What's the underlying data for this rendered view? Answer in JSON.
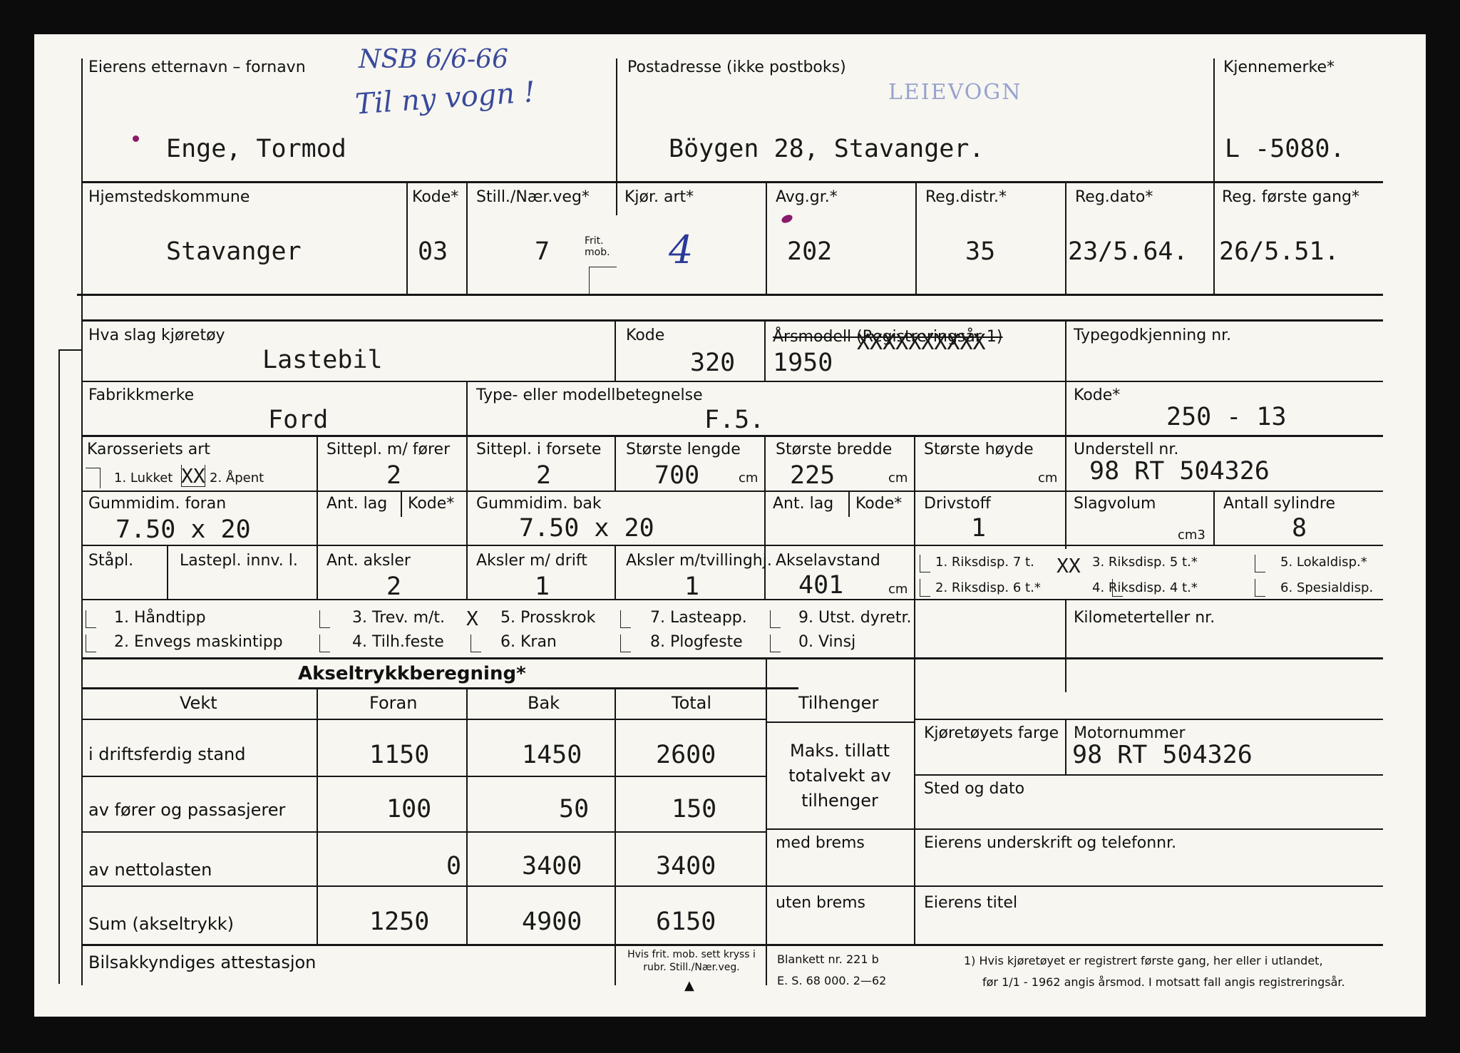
{
  "header": {
    "owner_label": "Eierens etternavn – fornavn",
    "owner_value": "Enge, Tormod",
    "annotation_line1": "NSB 6/6-66",
    "annotation_line2": "Til ny vogn !",
    "address_label": "Postadresse (ikke postboks)",
    "address_value": "Böygen 28, Stavanger.",
    "stamp": "LEIEVOGN",
    "reg_mark_label": "Kjennemerke*",
    "reg_mark_value": "L -5080."
  },
  "row2": {
    "municipality_label": "Hjemstedskommune",
    "municipality_value": "Stavanger",
    "kode_label": "Kode*",
    "kode_value": "03",
    "stilling_label": "Still./Nær.veg*",
    "stilling_value": "7",
    "frit_mob_label": "Frit. mob.",
    "kjor_art_label": "Kjør. art*",
    "kjor_art_value": "4",
    "avg_gr_label": "Avg.gr.*",
    "avg_gr_value": "202",
    "reg_distr_label": "Reg.distr.*",
    "reg_distr_value": "35",
    "reg_dato_label": "Reg.dato*",
    "reg_dato_value": "23/5.64.",
    "first_reg_label": "Reg. første gang*",
    "first_reg_value": "26/5.51."
  },
  "vehicle": {
    "type_label": "Hva slag kjøretøy",
    "type_value": "Lastebil",
    "kode_label": "Kode",
    "kode_value": "320",
    "year_label": "Årsmodell (Registreringsår 1)",
    "year_value": "1950",
    "year_crossout": "XXXXXXXXXX",
    "approval_label": "Typegodkjenning nr.",
    "make_label": "Fabrikkmerke",
    "make_value": "Ford",
    "model_label": "Type- eller modellbetegnelse",
    "model_value": "F.5.",
    "kode2_label": "Kode*",
    "kode2_value": "250 - 13",
    "body_label": "Karosseriets art",
    "body_opt1": "1. Lukket",
    "body_mark": "XX",
    "body_opt2": "2. Åpent",
    "seats_driver_label": "Sittepl. m/ fører",
    "seats_driver_value": "2",
    "seats_front_label": "Sittepl. i forsete",
    "seats_front_value": "2",
    "length_label": "Største lengde",
    "length_value": "700",
    "width_label": "Største bredde",
    "width_value": "225",
    "height_label": "Største høyde",
    "unit_cm": "cm",
    "chassis_label": "Understell nr.",
    "chassis_value": "98 RT 504326",
    "tyre_front_label": "Gummidim. foran",
    "tyre_front_value": "7.50 x 20",
    "ply_label": "Ant. lag",
    "kode3_label": "Kode*",
    "tyre_rear_label": "Gummidim. bak",
    "tyre_rear_value": "7.50 x 20",
    "fuel_label": "Drivstoff",
    "fuel_value": "1",
    "displacement_label": "Slagvolum",
    "unit_cm3": "cm3",
    "cylinders_label": "Antall sylindre",
    "cylinders_value": "8",
    "standing_label": "Ståpl.",
    "load_label": "Lastepl. innv. l.",
    "axles_label": "Ant. aksler",
    "axles_value": "2",
    "drive_axles_label": "Aksler m/ drift",
    "drive_axles_value": "1",
    "twin_axles_label": "Aksler m/tvillinghj.",
    "twin_axles_value": "1",
    "wheelbase_label": "Akselavstand",
    "wheelbase_value": "401",
    "disp1": "1. Riksdisp. 7 t.",
    "disp2": "2. Riksdisp. 6 t.*",
    "disp_mark": "XX",
    "disp3": "3. Riksdisp. 5 t.*",
    "disp4": "4. Riksdisp. 4 t.*",
    "disp5": "5. Lokaldisp.*",
    "disp6": "6. Spesialdisp.",
    "eq1": "1. Håndtipp",
    "eq2": "2. Envegs maskintipp",
    "eq3": "3. Trev. m/t.",
    "eq4": "4. Tilh.feste",
    "eq_mark": "X",
    "eq5": "5. Prosskrok",
    "eq6": "6. Kran",
    "eq7": "7. Lasteapp.",
    "eq8": "8. Plogfeste",
    "eq9": "9. Utst. dyretr.",
    "eq0": "0. Vinsj",
    "odometer_label": "Kilometerteller nr."
  },
  "axle_calc": {
    "title": "Akseltrykkberegning*",
    "columns": [
      "Vekt",
      "Foran",
      "Bak",
      "Total"
    ],
    "rows": [
      {
        "label": "i driftsferdig stand",
        "foran": "1150",
        "bak": "1450",
        "total": "2600"
      },
      {
        "label": "av fører og passasjerer",
        "foran": "100",
        "bak": "50",
        "total": "150"
      },
      {
        "label": "av nettolasten",
        "foran": "0",
        "bak": "3400",
        "total": "3400"
      },
      {
        "label": "Sum (akseltrykk)",
        "foran": "1250",
        "bak": "4900",
        "total": "6150"
      }
    ],
    "attest_label": "Bilsakkyndiges attestasjon",
    "note_frit": "Hvis frit. mob. sett kryss i rubr. Still./Nær.veg."
  },
  "trailer": {
    "title": "Tilhenger",
    "max_weight": "Maks. tillatt totalvekt av tilhenger",
    "with_brakes": "med brems",
    "without_brakes": "uten brems"
  },
  "right_block": {
    "color_label": "Kjøretøyets farge",
    "engine_label": "Motornummer",
    "engine_value": "98 RT 504326",
    "place_date_label": "Sted og dato",
    "signature_label": "Eierens underskrift og telefonnr.",
    "title_label": "Eierens titel"
  },
  "footer": {
    "form_no": "Blankett nr. 221 b",
    "es": "E. S. 68 000. 2—62",
    "note_line1": "1) Hvis kjøretøyet er registrert første gang, her eller i utlandet,",
    "note_line2": "før 1/1 - 1962 angis årsmod. I motsatt fall angis registreringsår."
  },
  "colors": {
    "card": "#f7f6f1",
    "ink": "#161616",
    "pen": "#3a4a9a",
    "stamp": "#4b61b0",
    "dot": "#8a1a6a"
  }
}
